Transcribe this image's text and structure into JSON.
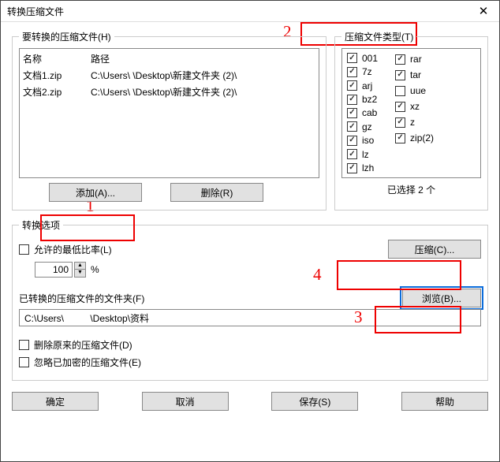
{
  "window": {
    "title": "转换压缩文件"
  },
  "files_group": {
    "legend": "要转换的压缩文件(H)",
    "col_name": "名称",
    "col_path": "路径",
    "rows": [
      {
        "name": "文档1.zip",
        "path": "C:\\Users\\          \\Desktop\\新建文件夹 (2)\\"
      },
      {
        "name": "文档2.zip",
        "path": "C:\\Users\\          \\Desktop\\新建文件夹 (2)\\"
      }
    ],
    "add_btn": "添加(A)...",
    "del_btn": "删除(R)"
  },
  "types_group": {
    "legend": "压缩文件类型(T)",
    "col1": [
      {
        "label": "001",
        "checked": true
      },
      {
        "label": "7z",
        "checked": true
      },
      {
        "label": "arj",
        "checked": true
      },
      {
        "label": "bz2",
        "checked": true
      },
      {
        "label": "cab",
        "checked": true
      },
      {
        "label": "gz",
        "checked": true
      },
      {
        "label": "iso",
        "checked": true
      },
      {
        "label": "lz",
        "checked": true
      },
      {
        "label": "lzh",
        "checked": true
      }
    ],
    "col2": [
      {
        "label": "rar",
        "checked": true
      },
      {
        "label": "tar",
        "checked": true
      },
      {
        "label": "uue",
        "checked": false
      },
      {
        "label": "xz",
        "checked": true
      },
      {
        "label": "z",
        "checked": true
      },
      {
        "label": "zip(2)",
        "checked": true
      }
    ],
    "selected_text": "已选择 2 个"
  },
  "conv": {
    "legend": "转换选项",
    "allow_min_ratio_label": "允许的最低比率(L)",
    "allow_min_ratio_checked": false,
    "ratio_value": "100",
    "ratio_suffix": "%",
    "compress_btn": "压缩(C)...",
    "folder_label": "已转换的压缩文件的文件夹(F)",
    "browse_btn": "浏览(B)...",
    "folder_path": "C:\\Users\\          \\Desktop\\资料",
    "del_orig_label": "删除原来的压缩文件(D)",
    "del_orig_checked": false,
    "skip_enc_label": "忽略已加密的压缩文件(E)",
    "skip_enc_checked": false
  },
  "bottom": {
    "ok": "确定",
    "cancel": "取消",
    "save": "保存(S)",
    "help": "帮助"
  },
  "annos": {
    "n1": "1",
    "n2": "2",
    "n3": "3",
    "n4": "4"
  }
}
